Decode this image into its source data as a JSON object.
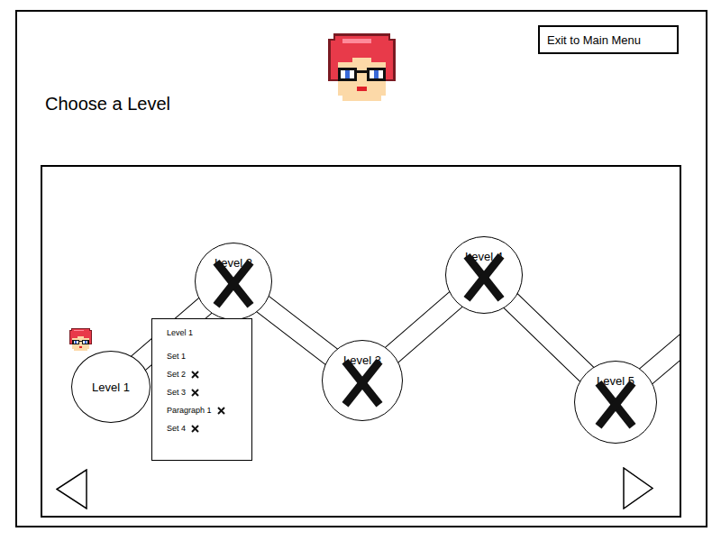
{
  "title": "Choose a Level",
  "exit_button": "Exit to Main Menu",
  "levels": [
    {
      "label": "Level 1",
      "locked": false,
      "current": true
    },
    {
      "label": "Level 2",
      "locked": true,
      "current": false
    },
    {
      "label": "Level 3",
      "locked": true,
      "current": false
    },
    {
      "label": "Level 4",
      "locked": true,
      "current": false
    },
    {
      "label": "Level 5",
      "locked": true,
      "current": false
    }
  ],
  "level_menu": {
    "title": "Level 1",
    "items": [
      {
        "label": "Set 1",
        "locked": false
      },
      {
        "label": "Set 2",
        "locked": true
      },
      {
        "label": "Set 3",
        "locked": true
      },
      {
        "label": "Paragraph 1",
        "locked": true
      },
      {
        "label": "Set 4",
        "locked": true
      }
    ]
  }
}
